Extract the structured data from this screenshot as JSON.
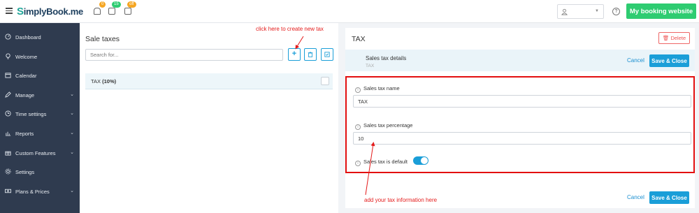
{
  "app": {
    "logo_prefix": "S",
    "logo_rest": "implyBook",
    "logo_suffix": ".me"
  },
  "topbar": {
    "badges": [
      "0",
      "15",
      "off"
    ],
    "booking_button": "My booking website",
    "help_label": "?",
    "icons": [
      "hamburger-icon",
      "bell-icon",
      "calendar-check-icon",
      "calendar-icon",
      "user-icon",
      "help-icon"
    ]
  },
  "sidebar": {
    "items": [
      {
        "label": "Dashboard",
        "icon": "dashboard-icon",
        "expandable": false
      },
      {
        "label": "Welcome",
        "icon": "lightbulb-icon",
        "expandable": false
      },
      {
        "label": "Calendar",
        "icon": "calendar-icon",
        "expandable": false
      },
      {
        "label": "Manage",
        "icon": "pencil-icon",
        "expandable": true
      },
      {
        "label": "Time settings",
        "icon": "clock-icon",
        "expandable": true
      },
      {
        "label": "Reports",
        "icon": "chart-icon",
        "expandable": true
      },
      {
        "label": "Custom Features",
        "icon": "gift-icon",
        "expandable": true
      },
      {
        "label": "Settings",
        "icon": "gear-icon",
        "expandable": false
      },
      {
        "label": "Plans & Prices",
        "icon": "money-icon",
        "expandable": true
      }
    ]
  },
  "left": {
    "title": "Sale taxes",
    "search_placeholder": "Search for...",
    "tax_row_name": "TAX",
    "tax_row_rate": "(10%)"
  },
  "right": {
    "title": "TAX",
    "delete_label": "Delete",
    "details_title": "Sales tax details",
    "details_sub": "TAX",
    "cancel_label": "Cancel",
    "save_label": "Save & Close",
    "fields": {
      "name_label": "Sales tax name",
      "name_value": "TAX",
      "percentage_label": "Sales tax percentage",
      "percentage_value": "10",
      "default_label": "Sales tax is default",
      "default_on": true
    }
  },
  "annotations": {
    "create_hint": "click here to create new tax",
    "info_hint": "add your tax information here",
    "color": "#e41b1b"
  },
  "colors": {
    "accent": "#1a9ed8",
    "green": "#2ecc71",
    "sidebar": "#2f3b4f"
  }
}
